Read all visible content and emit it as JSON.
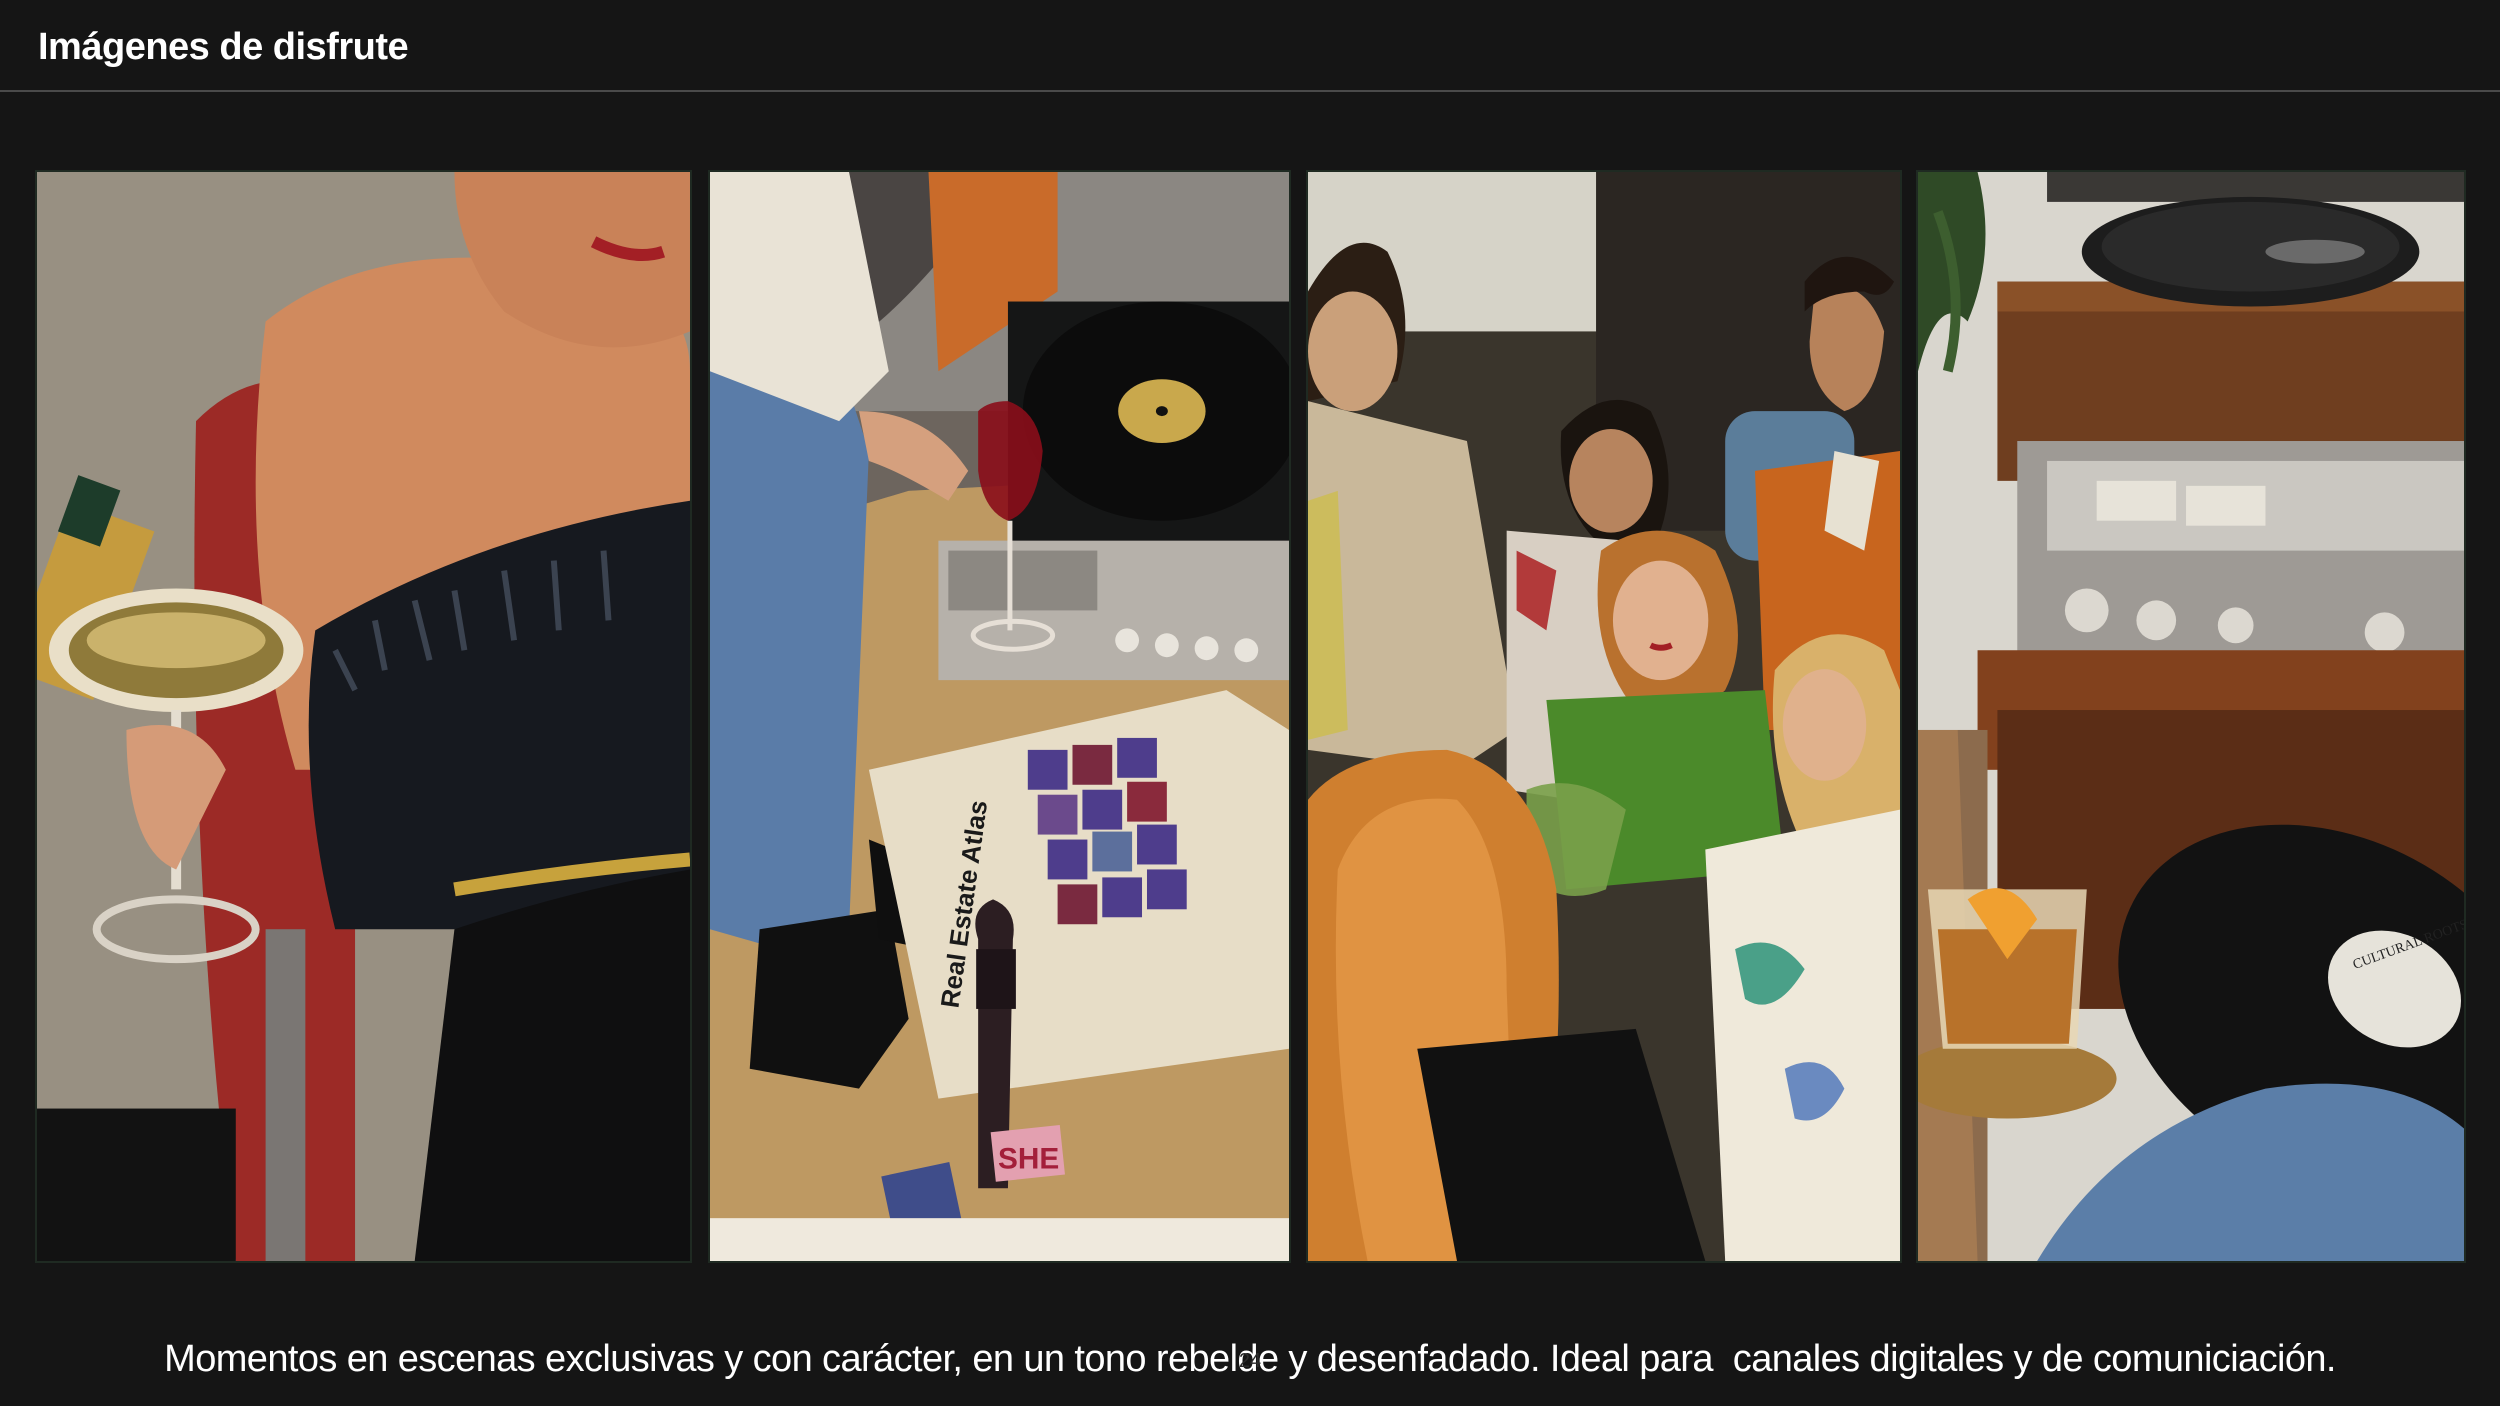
{
  "header": {
    "title": "Imágenes de disfrute"
  },
  "gallery": {
    "photos": [
      {
        "subject": "woman-with-champagne-photo"
      },
      {
        "subject": "record-player-wine-photo",
        "book_title": "Real Estate Atlas",
        "bottle_label": "SHE"
      },
      {
        "subject": "group-of-friends-photo"
      },
      {
        "subject": "turntable-vinyl-photo",
        "record_label": "CULTURAL ROOTS"
      }
    ]
  },
  "footer": {
    "caption": "Momentos en escenas exclusivas y con carácter, en un tono rebelde y desenfadado. Ideal para  canales digitales y de comuniciación.",
    "page_number": "24"
  },
  "colors": {
    "background": "#151515",
    "text": "#ffffff",
    "divider": "#4a4a4a"
  }
}
